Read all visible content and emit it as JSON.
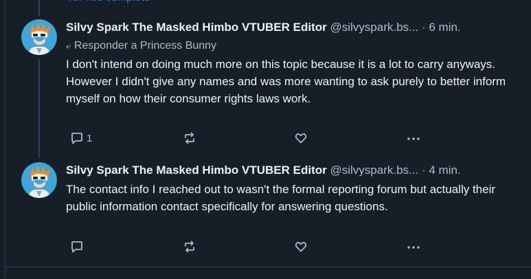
{
  "thread": {
    "partial_link": "Ver hilo completo"
  },
  "posts": [
    {
      "author_name": "Silvy Spark The Masked Himbo VTUBER Editor",
      "handle": "@silvyspark.bs...",
      "time": "· 6 min.",
      "reply_to": "Responder a Princess Bunny",
      "text": "I don't intend on doing much more on this topic because it is a lot to carry anyways. However I didn't give any names and was more wanting to ask purely to better inform myself on how their consumer rights laws work.",
      "reply_count": "1"
    },
    {
      "author_name": "Silvy Spark The Masked Himbo VTUBER Editor",
      "handle": "@silvyspark.bs...",
      "time": "· 4 min.",
      "text": "The contact info I reached out to wasn't the formal reporting forum but actually their public information contact specifically for answering questions.",
      "reply_count": ""
    }
  ],
  "colors": {
    "background": "#161e27",
    "text_primary": "#f1f3f5",
    "text_secondary": "#aebbc9",
    "accent": "#208bfe",
    "border": "#2e4052"
  },
  "icons": {
    "reply": "speech-bubble-icon",
    "repost": "repost-arrows-icon",
    "like": "heart-icon",
    "more": "ellipsis-icon",
    "reply_to": "reply-arrow-icon"
  }
}
